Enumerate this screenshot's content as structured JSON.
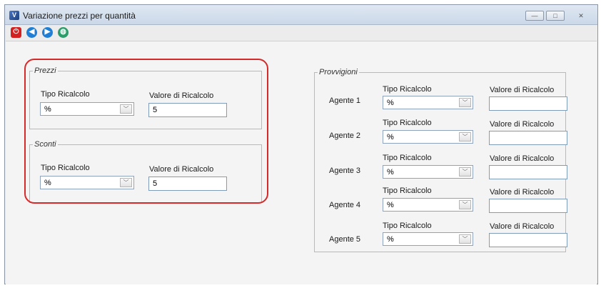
{
  "window": {
    "title": "Variazione prezzi per quantità",
    "min_glyph": "—",
    "max_glyph": "□",
    "close_glyph": "✕"
  },
  "toolbar": {
    "power_glyph": "⏻",
    "back_glyph": "◀",
    "forward_glyph": "▶",
    "globe_glyph": "◍",
    "colors": {
      "power": "#d42020",
      "nav": "#1f7fd6",
      "globe": "#2a9d6a"
    }
  },
  "prezzi": {
    "legend": "Prezzi",
    "tipo_label": "Tipo Ricalcolo",
    "tipo_value": "%",
    "valore_label": "Valore di Ricalcolo",
    "valore_value": "5"
  },
  "sconti": {
    "legend": "Sconti",
    "tipo_label": "Tipo Ricalcolo",
    "tipo_value": "%",
    "valore_label": "Valore di Ricalcolo",
    "valore_value": "5"
  },
  "provvigioni": {
    "legend": "Provvigioni",
    "agents": [
      {
        "name": "Agente 1",
        "tipo_label": "Tipo Ricalcolo",
        "tipo_value": "%",
        "valore_label": "Valore di Ricalcolo",
        "valore_value": ""
      },
      {
        "name": "Agente 2",
        "tipo_label": "Tipo Ricalcolo",
        "tipo_value": "%",
        "valore_label": "Valore di Ricalcolo",
        "valore_value": ""
      },
      {
        "name": "Agente 3",
        "tipo_label": "Tipo Ricalcolo",
        "tipo_value": "%",
        "valore_label": "Valore di Ricalcolo",
        "valore_value": ""
      },
      {
        "name": "Agente 4",
        "tipo_label": "Tipo Ricalcolo",
        "tipo_value": "%",
        "valore_label": "Valore di Ricalcolo",
        "valore_value": ""
      },
      {
        "name": "Agente 5",
        "tipo_label": "Tipo Ricalcolo",
        "tipo_value": "%",
        "valore_label": "Valore di Ricalcolo",
        "valore_value": ""
      }
    ]
  },
  "arrow_glyph": "﹀",
  "highlight_color": "#d62a2a"
}
